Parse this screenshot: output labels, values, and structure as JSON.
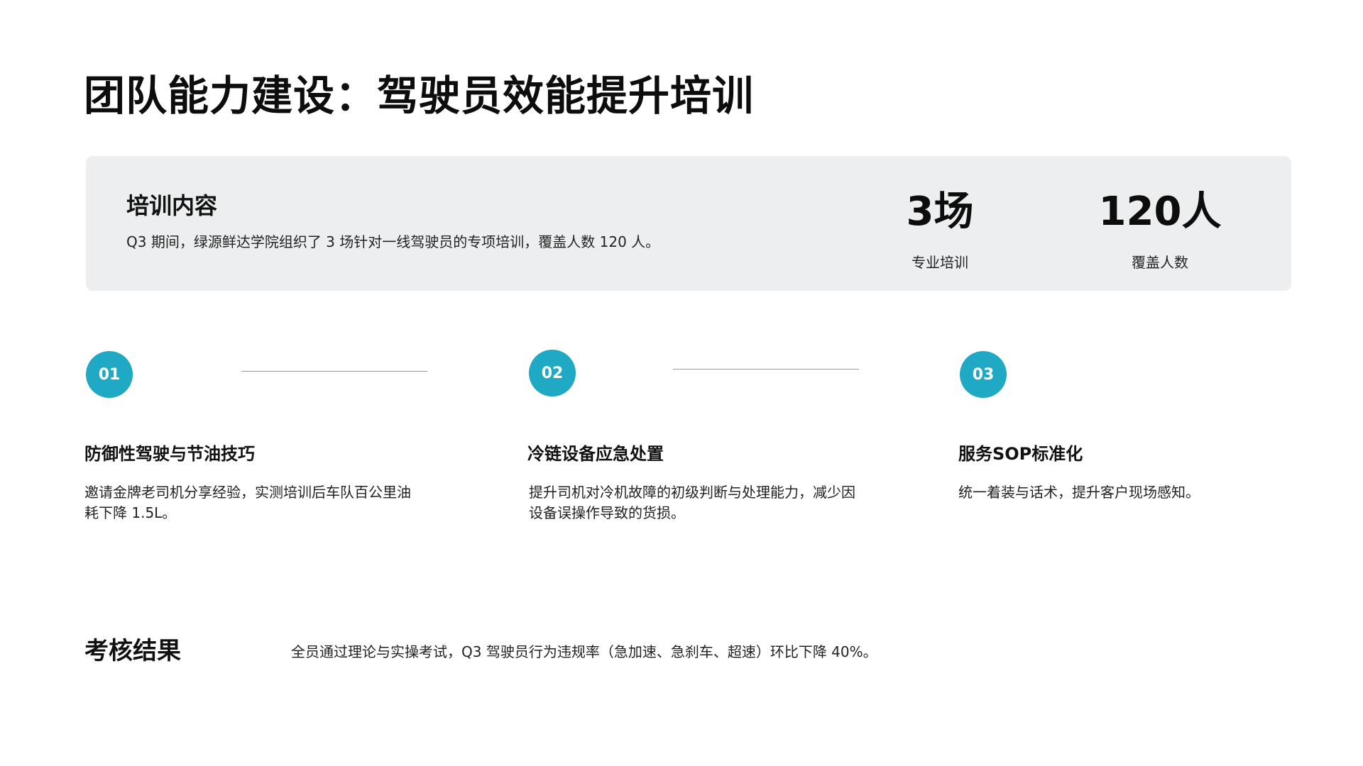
{
  "title": "团队能力建设：驾驶员效能提升培训",
  "summary": {
    "heading": "培训内容",
    "text": "Q3 期间，绿源鲜达学院组织了 3 场针对一线驾驶员的专项培训，覆盖人数 120 人。",
    "stats": [
      {
        "value": "3场",
        "label": "专业培训"
      },
      {
        "value": "120人",
        "label": "覆盖人数"
      }
    ]
  },
  "steps": [
    {
      "number": "01",
      "title": "防御性驾驶与节油技巧",
      "description": "邀请金牌老司机分享经验，实测培训后车队百公里油耗下降 1.5L。"
    },
    {
      "number": "02",
      "title": "冷链设备应急处置",
      "description": "提升司机对冷机故障的初级判断与处理能力，减少因设备误操作导致的货损。"
    },
    {
      "number": "03",
      "title": "服务SOP标准化",
      "description": "统一着装与话术，提升客户现场感知。"
    }
  ],
  "result": {
    "heading": "考核结果",
    "text": "全员通过理论与实操考试，Q3 驾驶员行为违规率（急加速、急刹车、超速）环比下降 40%。"
  },
  "colors": {
    "accent": "#1fa9c4",
    "card_background": "#eceeef",
    "connector": "#9a9a9a"
  }
}
